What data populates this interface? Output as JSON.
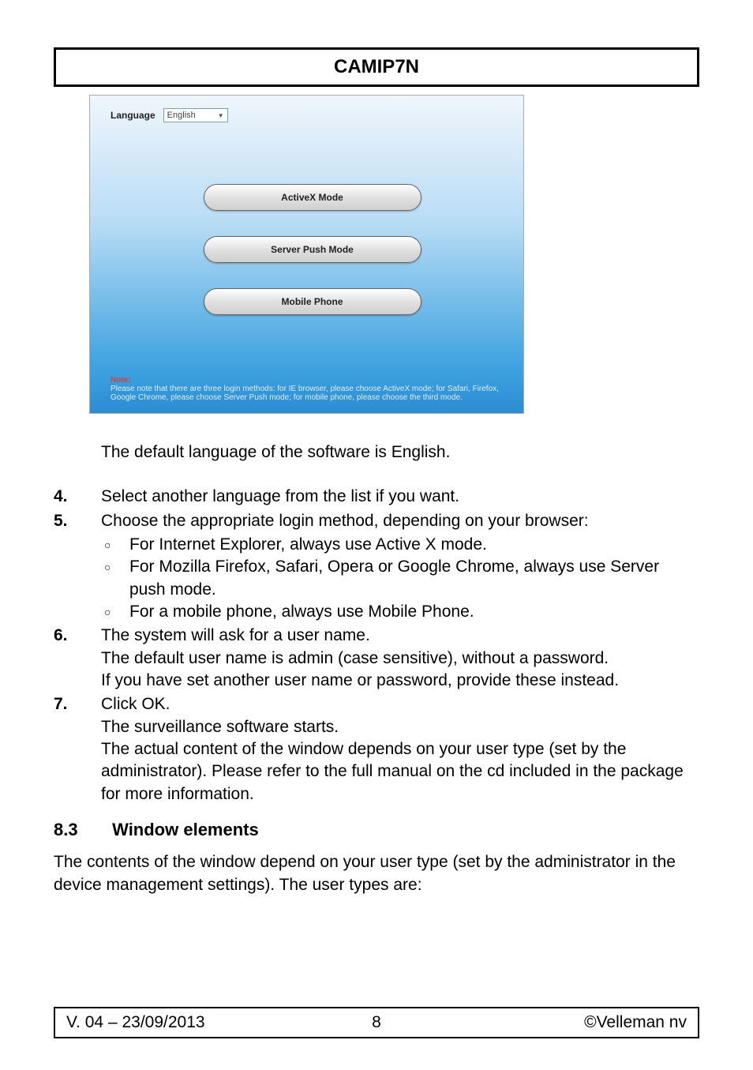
{
  "header": {
    "title": "CAMIP7N"
  },
  "screenshot": {
    "language_label": "Language",
    "language_value": "English",
    "buttons": {
      "activex": "ActiveX Mode",
      "server_push": "Server Push Mode",
      "mobile": "Mobile Phone"
    },
    "note_title": "Note:",
    "note_text": "Please note that there are three login methods: for IE browser, please choose ActiveX mode; for Safari, Firefox, Google Chrome, please choose Server Push mode; for mobile phone, please choose the third mode."
  },
  "intro": "The default language of the software is English.",
  "steps": {
    "s4_num": "4.",
    "s4": "Select another language from the list if you want.",
    "s5_num": "5.",
    "s5": "Choose the appropriate login method, depending on your browser:",
    "s5_a": "For Internet Explorer, always use Active X mode.",
    "s5_b": "For Mozilla Firefox, Safari, Opera or Google Chrome, always use Server push mode.",
    "s5_c": "For a mobile phone, always use Mobile Phone.",
    "s6_num": "6.",
    "s6_a": "The system will ask for a user name.",
    "s6_b": "The default user name is admin (case sensitive), without a password.",
    "s6_c": "If you have set another user name or password, provide these instead.",
    "s7_num": "7.",
    "s7_a": "Click OK.",
    "s7_b": "The surveillance software starts.",
    "s7_c": "The actual content of the window depends on your user type (set by the administrator). Please refer to the full manual on the cd included in the package for more information."
  },
  "section": {
    "num": "8.3",
    "title": "Window elements",
    "para": "The contents of the window depend on your user type (set by the administrator in the device management settings). The user types are:"
  },
  "footer": {
    "version": "V. 04 – 23/09/2013",
    "page": "8",
    "copyright": "©Velleman nv"
  }
}
